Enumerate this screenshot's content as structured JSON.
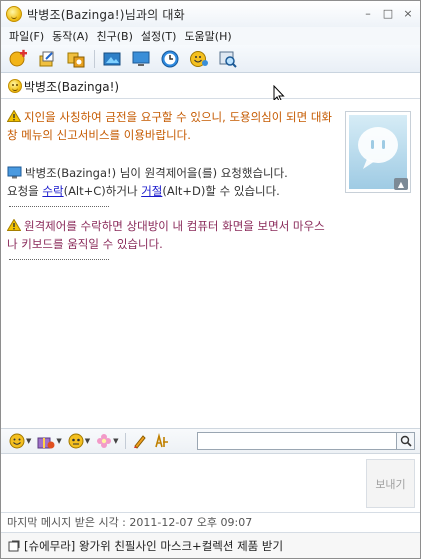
{
  "window": {
    "title": "박병조(Bazinga!)님과의 대화",
    "buttons": {
      "minimize": "–",
      "maximize": "□",
      "close": "×"
    }
  },
  "menu": {
    "items": [
      "파일(F)",
      "동작(A)",
      "친구(B)",
      "설정(T)",
      "도움말(H)"
    ]
  },
  "toolbar": {
    "icons": [
      "add-friend-icon",
      "send-file-icon",
      "invite-icon",
      "photo-icon",
      "screen-icon",
      "clock-icon",
      "emoticon-icon",
      "search-icon"
    ]
  },
  "contact": {
    "name": "박병조(Bazinga!)"
  },
  "chat": {
    "messages": {
      "warning1": "지인을 사칭하여 금전을 요구할 수 있으니, 도용의심이 되면 대화창 메뉴의 신고서비스를 이용바랍니다.",
      "request_line1": "박병조(Bazinga!) 님이 원격제어을(를) 요청했습니다.",
      "request_prefix": "요청을 ",
      "accept_link": "수락",
      "accept_shortcut": "(Alt+C)하거나 ",
      "reject_link": "거절",
      "reject_suffix": "(Alt+D)할 수 있습니다.",
      "warning2": "원격제어를 수락하면 상대방이 내 컴퓨터 화면을 보면서 마우스나 키보드를 움직일 수 있습니다."
    }
  },
  "input": {
    "send_label": "보내기"
  },
  "status": {
    "last_message": "마지막 메시지 받은 시각 : 2011-12-07 오후 09:07"
  },
  "ad": {
    "text": "[슈에무라] 왕가위 친필사인 마스크+컬렉션 제품 받기"
  },
  "colors": {
    "warning": "#c55a00",
    "warning_purple": "#8a2a5a",
    "link": "#1a1acc"
  }
}
